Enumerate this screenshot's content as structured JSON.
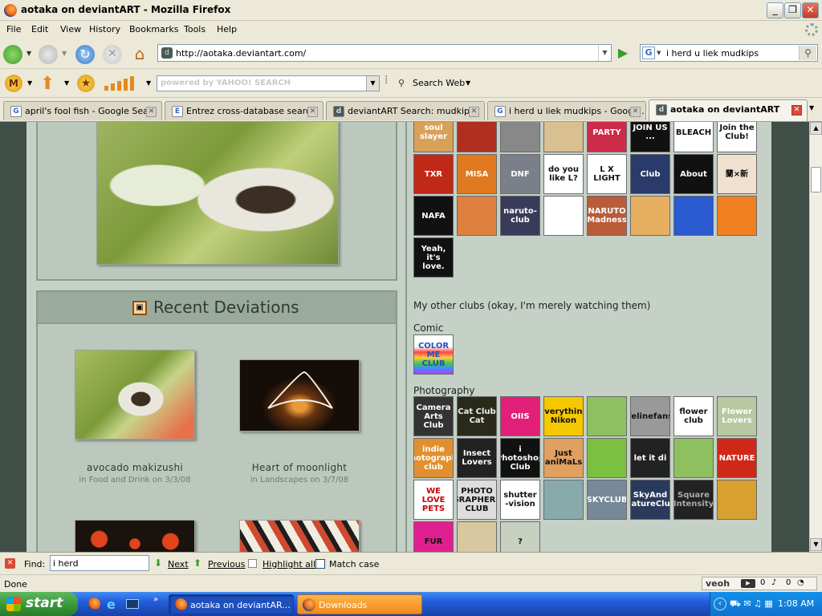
{
  "window": {
    "title": "aotaka on deviantART - Mozilla Firefox"
  },
  "menu": [
    "File",
    "Edit",
    "View",
    "History",
    "Bookmarks",
    "Tools",
    "Help"
  ],
  "address": {
    "url": "http://aotaka.deviantart.com/"
  },
  "search": {
    "engine_glyph": "G",
    "value": "i herd u liek mudkips"
  },
  "yahoo": {
    "placeholder": "powered by YAHOO! SEARCH",
    "search_web": "Search Web"
  },
  "tabs": [
    {
      "label": "april's fool fish - Google Sea...",
      "icon": "G"
    },
    {
      "label": "Entrez cross-database search",
      "icon": "E"
    },
    {
      "label": "deviantART Search: mudkips",
      "icon": "d"
    },
    {
      "label": "i herd u liek mudkips - Googl...",
      "icon": "G"
    },
    {
      "label": "aotaka on deviantART",
      "icon": "d"
    }
  ],
  "recent": {
    "heading": "Recent Deviations",
    "items": [
      {
        "title": "avocado makizushi",
        "sub": "in Food and Drink on 3/3/08"
      },
      {
        "title": "Heart of moonlight",
        "sub": "in Landscapes on 3/7/08"
      }
    ]
  },
  "clubs": {
    "row1": [
      "soul slayer",
      "",
      "",
      "",
      "PARTY",
      "JOIN US ...",
      "BLEACH",
      "Join the Club!"
    ],
    "row2": [
      "TXR",
      "MISA",
      "DNF",
      "do you like L?",
      "L X LIGHT",
      "Club",
      "About",
      "蘭×新"
    ],
    "row3": [
      "NAFA",
      "",
      "naruto-club",
      "",
      "NARUTO Madness",
      "",
      "",
      ""
    ],
    "row4": [
      "Yeah, it's love."
    ],
    "other_heading": "My other clubs (okay, I'm merely watching them)",
    "comic_label": "Comic",
    "comic": [
      "COLOR ME CLUB"
    ],
    "photo_label": "Photography",
    "photo_row1": [
      "Camera Arts Club",
      "Cat Club Cat",
      "OIIS",
      "Everything Nikon",
      "",
      "felinefans",
      "flower club",
      "Flower Lovers"
    ],
    "photo_row2": [
      "indie photography club",
      "Insect Lovers",
      "i Photoshop Club",
      "Just aniMaLs",
      "",
      "let it di",
      "",
      "NATURE"
    ],
    "photo_row3": [
      "WE LOVE PETS",
      "PHOTO GRAPHERS CLUB",
      "shutter -vision",
      "",
      "SKYCLUB",
      "SkyAnd NatureClub",
      "Square Intensity",
      ""
    ],
    "photo_row4": [
      "FUR",
      "",
      "?"
    ]
  },
  "findbar": {
    "label": "Find:",
    "value": "i herd",
    "next": "Next",
    "previous": "Previous",
    "highlight": "Highlight all",
    "match_case": "Match case"
  },
  "status": {
    "text": "Done",
    "veoh": "veoh",
    "c1": "0",
    "c2": "0"
  },
  "taskbar": {
    "start": "start",
    "items": [
      "aotaka on deviantAR...",
      "Downloads"
    ],
    "clock": "1:08 AM"
  }
}
